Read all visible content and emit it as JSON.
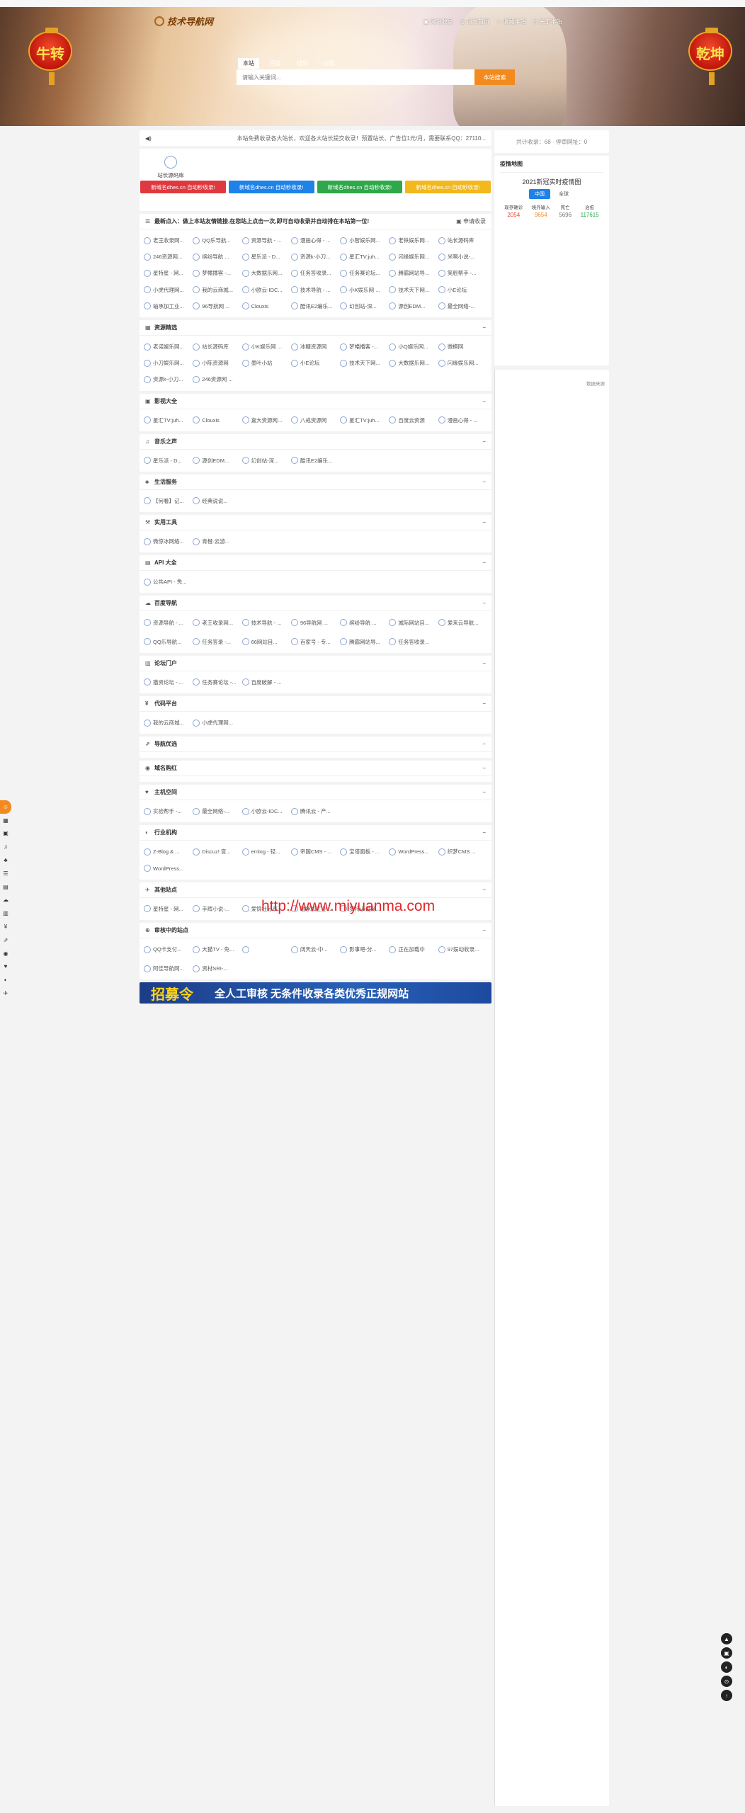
{
  "site": {
    "logo_text": "技术导航网",
    "top_links": [
      "▣ 网站收录",
      "◎ 设为首页",
      "☆ 收藏本站",
      "⊙ 关于本站"
    ]
  },
  "banner": {
    "lantern_left": "牛转",
    "lantern_right": "乾坤"
  },
  "search": {
    "tabs": [
      "本站",
      "百度",
      "搜狗",
      "必应"
    ],
    "active_tab": "本站",
    "placeholder": "请输入关键词...",
    "button": "本站搜索"
  },
  "notice": {
    "icon": "speaker-icon",
    "text": "本站免费收录各大站长，欢迎各大站长提交收录！预置站长、广告位1元/月，需要联系QQ：27110..."
  },
  "featured": {
    "site_name": "站长源码库"
  },
  "promo_buttons": [
    {
      "label": "新域名dhes.cn 自动秒收录!",
      "color": "#e0383f"
    },
    {
      "label": "新域名dhes.cn 自动秒收录!",
      "color": "#1e82e8"
    },
    {
      "label": "新域名dhes.cn 自动秒收录!",
      "color": "#2ea84a"
    },
    {
      "label": "新域名dhes.cn 自动秒收录!",
      "color": "#f2b81c"
    }
  ],
  "sections": [
    {
      "title": "最新点入：做上本站友情链接,在您站上点击一次,即可自动收录并自动排在本站第一位!",
      "right": "▣ 申请收录",
      "items": [
        "老王收录网...",
        "QQ乐导航...",
        "资源导航 - ...",
        "漫画心得 - ...",
        "小智娱乐网...",
        "老铁娱乐网...",
        "站长源码库",
        "246资源网...",
        "缤纷导航 ...",
        "星乐派 - D...",
        "资源k-小刀...",
        "星汇TV:juh...",
        "闪缘娱乐网...",
        "米啊小说-...",
        "星特星 - 网...",
        "梦幡播客 -...",
        "大数据乐网...",
        "任务答收录...",
        "任务赛论坛...",
        "腾霸网站导...",
        "笑脸帮手 -...",
        "小虎代理网...",
        "我的云商城...",
        "小欧云-IDC...",
        "技术导航 - ...",
        "小K娱乐网 ...",
        "技术天下网...",
        "小E论坛",
        "轴承加工业...",
        "96导航网 ...",
        "Clouxis",
        "酷讯E2编乐...",
        "幻创站-深...",
        "源创EDM...",
        "最全网络-..."
      ]
    },
    {
      "title": "资源精选",
      "right": "−",
      "items": [
        "老诺娱乐网...",
        "站长源码库",
        "小K娱乐网 ...",
        "冰糖资源网",
        "梦幡播客 -...",
        "小Q娱乐网...",
        "微模网",
        "小刀娱乐网...",
        "小陈资源网",
        "墨叶小站",
        "小E论坛",
        "技术天下网...",
        "大数据乐网...",
        "闪缘娱乐网...",
        "资源k-小刀...",
        "246资源网 ..."
      ]
    },
    {
      "title": "影视大全",
      "right": "−",
      "items": [
        "星汇TV:juh...",
        "Clouxis",
        "嘉大资源网...",
        "八戒资源网",
        "星汇TV:juh...",
        "百度云资源",
        "漫画心得 - ..."
      ]
    },
    {
      "title": "音乐之声",
      "right": "−",
      "items": [
        "星乐派 - D...",
        "源创EDM...",
        "幻创站-深...",
        "酷讯E2编乐..."
      ]
    },
    {
      "title": "生活服务",
      "right": "−",
      "items": [
        "【何看】记...",
        "经典说说..."
      ]
    },
    {
      "title": "实用工具",
      "right": "−",
      "items": [
        "微惊冰网络...",
        "青橙·云游..."
      ]
    },
    {
      "title": "API 大全",
      "right": "−",
      "items": [
        "公共API - 免..."
      ]
    },
    {
      "title": "百度导航",
      "right": "−",
      "items": [
        "资源导航 - ...",
        "老王收录网...",
        "技术导航 - ...",
        "96导航网 ...",
        "缤纷导航 ...",
        "城际网站目...",
        "爱来云导航..."
      ],
      "items2": [
        "QQ乐导航...",
        "任务答录 -...",
        "66网站目...",
        "百家号 - 专...",
        "腾霸网站导...",
        "任务答收录..."
      ]
    },
    {
      "title": "论坛门户",
      "right": "−",
      "items": [
        "猫资论坛 - ...",
        "任务赛论坛 -...",
        "百度破解 - ..."
      ]
    },
    {
      "title": "代码平台",
      "right": "−",
      "items": [
        "我的云商城...",
        "小虎代理网..."
      ]
    },
    {
      "title": "导航优选",
      "right": "−",
      "items": []
    },
    {
      "title": "域名购红",
      "right": "−",
      "items": []
    },
    {
      "title": "主机空间",
      "right": "−",
      "items": [
        "实验帮手 -...",
        "最全网络-...",
        "小欧云-IDC...",
        "腾讯云 - 产..."
      ]
    },
    {
      "title": "行业机构",
      "right": "−",
      "items": [
        "Z-Blog & ...",
        "Discuz! 官...",
        "emlog - 轻...",
        "帝国CMS - ...",
        "宝塔面板 - ...",
        "WordPress...",
        "织梦CMS ...",
        "WordPress..."
      ]
    },
    {
      "title": "其他站点",
      "right": "−",
      "items": [
        "星特星 - 网...",
        "手辉小说-...",
        "爱锦社分享...",
        "轴承加工业...",
        "梦特小说网..."
      ]
    },
    {
      "title": "审核中的站点",
      "right": "−",
      "items": [
        "QQ卡支付...",
        "大猫TV - 免...",
        "",
        "阔天云-中...",
        "影事吧-分...",
        "正在加载中",
        "97娱动收录..."
      ],
      "items2": [
        "阿佳导航网...",
        "资材SRI-..."
      ]
    }
  ],
  "ad": {
    "big": "招募令",
    "text": "全人工审核   无条件收录各类优秀正规网站"
  },
  "watermark": "http://www.miyuanma.com",
  "sidebar": {
    "stats": "共计收录：68 · 停审网址：0",
    "covid_title": "疫情地图",
    "covid_heading": "2021新冠实时疫情图",
    "covid_tabs": [
      "中国",
      "全球"
    ],
    "covid_labels": [
      "现存确诊",
      "境外输入",
      "死亡",
      "治愈"
    ],
    "covid_values": [
      "2054",
      "9654",
      "5696",
      "117615"
    ],
    "covid_colors": [
      "#e8442c",
      "#f28a1f",
      "#777777",
      "#2ea84a"
    ],
    "covid_source": "数据来源"
  },
  "left_tools": [
    "☺",
    "▦",
    "▣",
    "♫",
    "♣",
    "☰",
    "▤",
    "☁",
    "▥",
    "¥",
    "⇗",
    "◉",
    "♥",
    "◐",
    "✈"
  ],
  "right_tools": [
    "▲",
    "▣",
    "◐",
    "⊙",
    "↑"
  ]
}
